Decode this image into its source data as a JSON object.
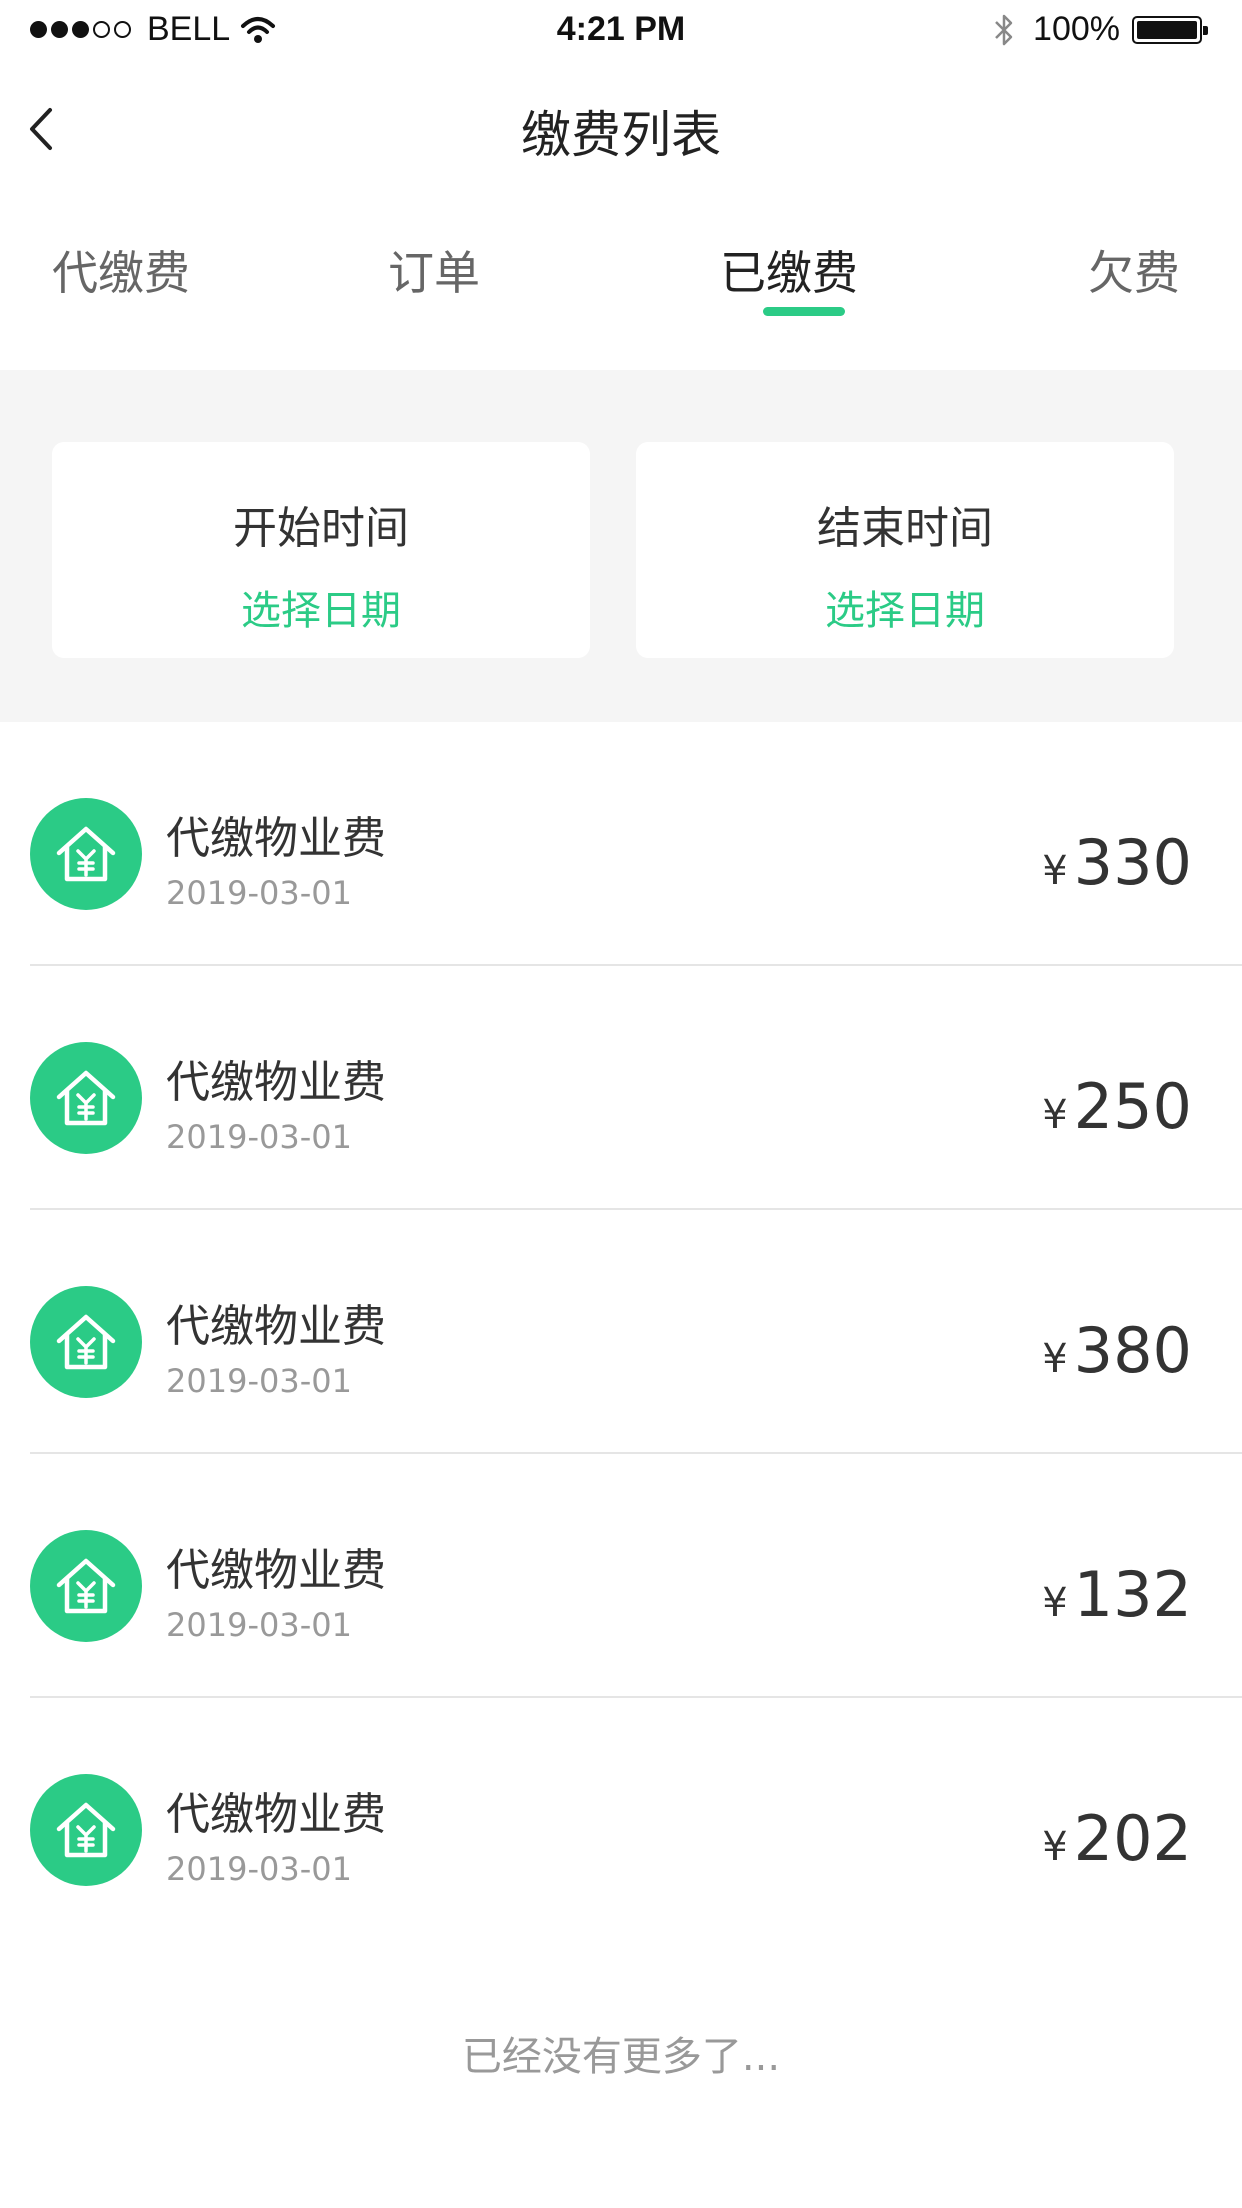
{
  "status_bar": {
    "carrier": "BELL",
    "time": "4:21 PM",
    "battery": "100%",
    "signal_icon": "signal-dots-icon",
    "wifi_icon": "wifi-icon",
    "bluetooth_icon": "bluetooth-icon",
    "battery_icon": "battery-icon"
  },
  "nav": {
    "title": "缴费列表",
    "back_icon": "chevron-left-icon"
  },
  "tabs": [
    {
      "label": "代缴费",
      "active": false
    },
    {
      "label": "订单",
      "active": false
    },
    {
      "label": "已缴费",
      "active": true
    },
    {
      "label": "欠费",
      "active": false
    }
  ],
  "filter": {
    "start": {
      "label": "开始时间",
      "placeholder": "选择日期"
    },
    "end": {
      "label": "结束时间",
      "placeholder": "选择日期"
    }
  },
  "items": [
    {
      "title": "代缴物业费",
      "date": "2019-03-01",
      "currency": "¥",
      "amount": "330"
    },
    {
      "title": "代缴物业费",
      "date": "2019-03-01",
      "currency": "¥",
      "amount": "250"
    },
    {
      "title": "代缴物业费",
      "date": "2019-03-01",
      "currency": "¥",
      "amount": "380"
    },
    {
      "title": "代缴物业费",
      "date": "2019-03-01",
      "currency": "¥",
      "amount": "132"
    },
    {
      "title": "代缴物业费",
      "date": "2019-03-01",
      "currency": "¥",
      "amount": "202"
    }
  ],
  "list_end_text": "已经没有更多了...",
  "colors": {
    "accent": "#2bcb86",
    "background_gray": "#f5f5f5",
    "text_primary": "#333333",
    "text_secondary": "#999999"
  },
  "item_icon": "house-yuan-icon"
}
